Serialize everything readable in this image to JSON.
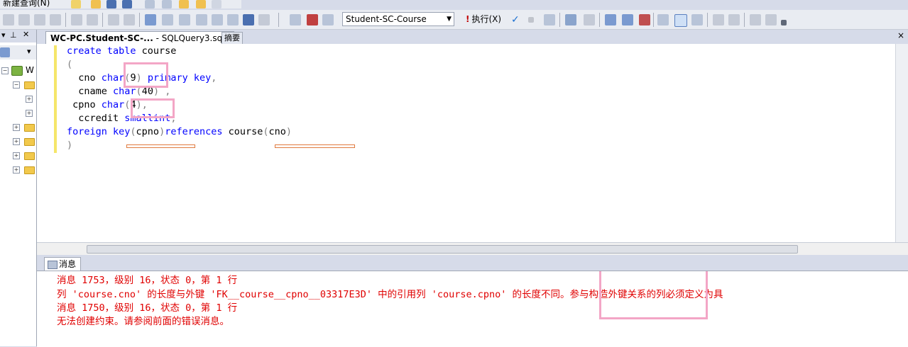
{
  "toolbar": {
    "new_query_label": "新建查询(N)",
    "database": "Student-SC-Course",
    "execute_label": "执行(X)",
    "icons": [
      "indent-icon",
      "outdent-icon",
      "comment-icon",
      "uncomment-icon",
      "results-text-icon",
      "results-grid-icon",
      "results-file-icon",
      "check-icon",
      "stop-icon",
      "parse-icon",
      "estimated-plan-icon",
      "intellisense-icon",
      "query-options-icon",
      "include-plan-icon",
      "client-stats-icon"
    ]
  },
  "explorer": {
    "pin_icon": "pin-icon",
    "close_icon": "close-icon",
    "server_label": "W"
  },
  "tabs": {
    "active_bold": "WC-PC.Student-SC-...",
    "active_rest": " - SQLQuery3.sql*",
    "close_glyph": "×",
    "summary": "摘要"
  },
  "editor": {
    "lines": [
      {
        "t1": "create table ",
        "t2": "course"
      },
      {
        "t1": "("
      },
      {
        "t1": "  cno ",
        "t2": "char",
        "t3": "(",
        "t4": "9",
        "t5": ") ",
        "t6": "primary key",
        "t7": ","
      },
      {
        "t1": "  cname ",
        "t2": "char",
        "t3": "(",
        "t4": "40",
        "t5": ") ",
        "t7": ","
      },
      {
        "t1": " cpno ",
        "t2": "char",
        "t3": "(",
        "t4": "4",
        "t5": ")",
        "t7": ","
      },
      {
        "t1": "  ccredit ",
        "t2": "smallint",
        "t7": ","
      },
      {
        "t1": "foreign key",
        "t2": "(",
        "t3": "cpno",
        "t4": ")",
        "t5": "references ",
        "t6": "course",
        "t7": "(",
        "t8": "cno",
        "t9": ")"
      },
      {
        "t1": ")"
      }
    ]
  },
  "messages": {
    "tab_label": "消息",
    "lines": [
      "消息 1753，级别 16，状态 0，第 1 行",
      "列 'course.cno' 的长度与外键 'FK__course__cpno__03317E3D' 中的引用列 'course.cpno' 的长度不同。参与构造外键关系的列必须定义为具",
      "消息 1750，级别 16，状态 0，第 1 行",
      "无法创建约束。请参阅前面的错误消息。"
    ]
  },
  "colors": {
    "keyword": "#0000ff",
    "error": "#e00000",
    "annotation_pink": "#f3a6c6",
    "annotation_orange": "#e07a3f"
  }
}
